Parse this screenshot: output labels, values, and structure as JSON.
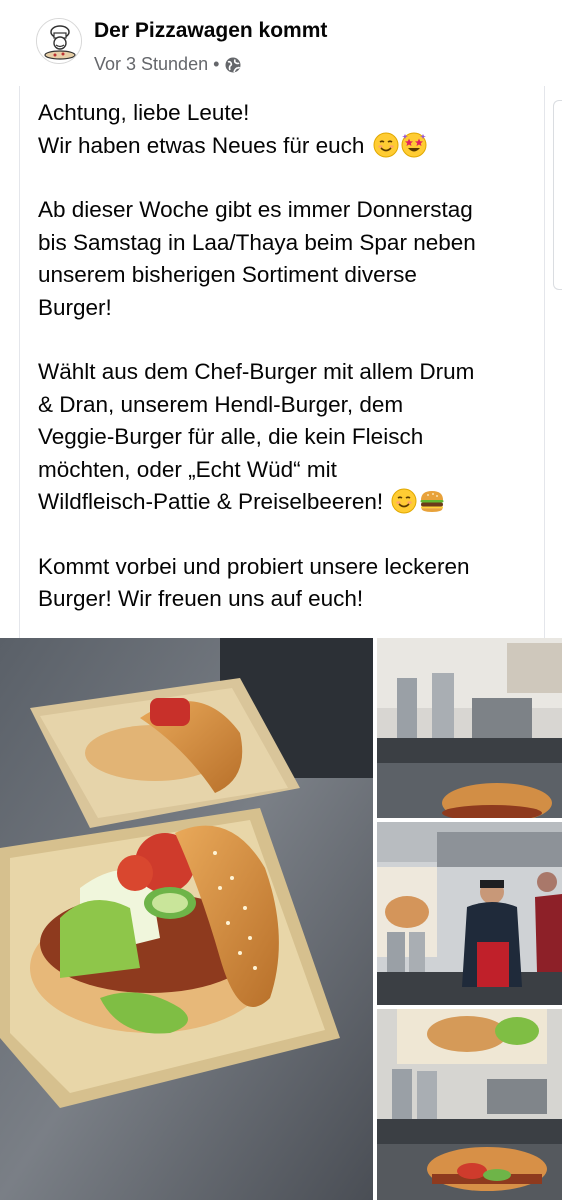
{
  "post": {
    "page_name": "Der Pizzawagen kommt",
    "time": "Vor 3 Stunden",
    "separator": "•",
    "privacy_icon": "globe-icon",
    "lines": [
      "Achtung, liebe Leute!",
      "Wir haben etwas Neues für euch",
      "",
      "Ab dieser Woche gibt es immer Donnerstag",
      "bis Samstag in Laa/Thaya beim Spar neben",
      "unserem bisherigen Sortiment diverse",
      "Burger!",
      "",
      "Wählt aus dem Chef-Burger mit allem Drum",
      "& Dran, unserem Hendl-Burger, dem",
      "Veggie-Burger für alle, die kein Fleisch",
      "möchten, oder „Echt Wüd“ mit",
      "Wildfleisch-Pattie & Preiselbeeren!",
      "",
      "Kommt vorbei und probiert unsere leckeren",
      "Burger! Wir freuen uns auf euch!"
    ]
  },
  "photos": {
    "main": "burger-photo",
    "side": [
      "kitchen-burger-photo",
      "chef-kitchen-photo",
      "kitchen-counter-photo"
    ]
  },
  "icons": {
    "avatar": "pizza-chef-logo-icon",
    "emoji_smile": "smiling-face-emoji-icon",
    "emoji_star": "star-struck-emoji-icon",
    "emoji_burger": "hamburger-emoji-icon"
  },
  "colors": {
    "text": "#050505",
    "meta": "#65676b",
    "border": "#e4e6eb"
  }
}
